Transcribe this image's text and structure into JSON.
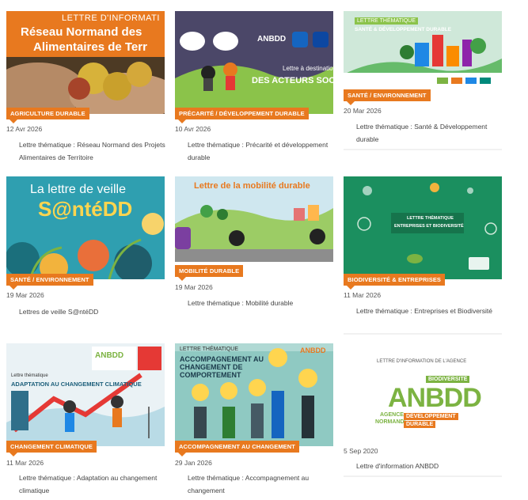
{
  "cards": [
    {
      "tag": "Agriculture durable",
      "date": "12 Avr 2026",
      "title": "Lettre thématique : Réseau Normand des Projets Alimentaires de Territoire",
      "banner": [
        "LETTRE D'INFORMATI",
        "Réseau Normand des",
        "Alimentaires de Terr"
      ]
    },
    {
      "tag": "Précarité / Développement durable",
      "date": "10 Avr 2026",
      "title": "Lettre thématique : Précarité et développement durable",
      "banner": [
        "Lettre à destination",
        "DES ACTEURS SOCIAUX",
        "ANBDD"
      ]
    },
    {
      "tag": "Santé / Environnement",
      "date": "20 Mar 2026",
      "title": "Lettre thématique : Santé & Développement durable",
      "banner": [
        "LETTRE THÉMATIQUE",
        "SANTÉ & DÉVELOPPEMENT DURABLE"
      ]
    },
    {
      "tag": "Santé / Environnement",
      "date": "19 Mar 2026",
      "title": "Lettres de veille S@ntéDD",
      "banner": [
        "La lettre de veille",
        "S@ntéDD"
      ]
    },
    {
      "tag": "Mobilité durable",
      "date": "19 Mar 2026",
      "title": "Lettre thématique : Mobilité durable",
      "banner": [
        "Lettre de la mobilité durable"
      ]
    },
    {
      "tag": "Biodiversité & entreprises",
      "date": "11 Mar 2026",
      "title": "Lettre thématique : Entreprises et Biodiversité",
      "banner": [
        "LETTRE THÉMATIQUE",
        "ENTREPRISES ET BIODIVERSITÉ"
      ]
    },
    {
      "tag": "Changement climatique",
      "date": "11 Mar 2026",
      "title": "Lettre thématique : Adaptation au changement climatique",
      "banner": [
        "Lettre thématique",
        "ADAPTATION AU CHANGEMENT CLIMATIQUE",
        "ANBDD"
      ]
    },
    {
      "tag": "Accompagnement au changement",
      "date": "29 Jan 2026",
      "title": "Lettre thématique : Accompagnement au changement",
      "banner": [
        "LETTRE THÉMATIQUE",
        "ACCOMPAGNEMENT AU",
        "CHANGEMENT DE",
        "COMPORTEMENT",
        "ANBDD"
      ]
    },
    {
      "tag": "",
      "date": "5 Sep 2020",
      "title": "Lettre d'information ANBDD",
      "banner": [
        "LETTRE D'INFORMATION DE L'AGENCE",
        "BIODIVERSITÉ",
        "ANBDD",
        "AGENCE",
        "NORMANDE",
        "DÉVELOPPEMENT",
        "DURABLE"
      ]
    }
  ],
  "colors": {
    "tag": "#e8791f",
    "anbdd_green": "#7cb342",
    "anbdd_orange": "#e8791f"
  }
}
